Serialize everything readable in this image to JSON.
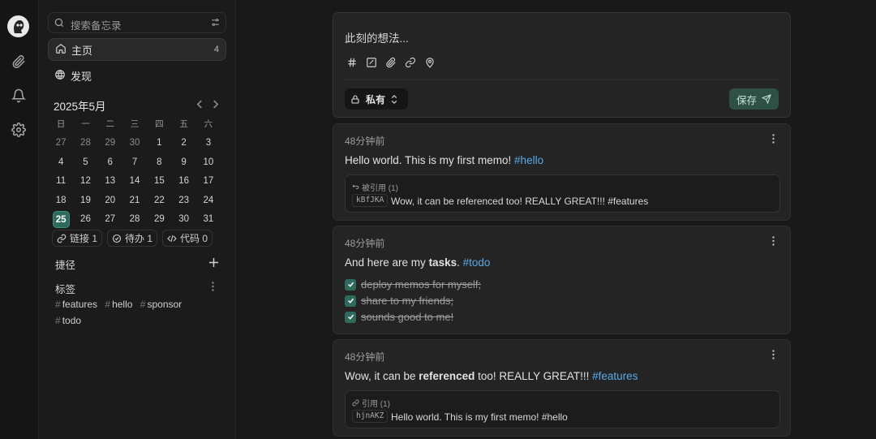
{
  "search": {
    "placeholder": "搜索备忘录"
  },
  "nav": {
    "home": {
      "label": "主页",
      "count": "4"
    },
    "explore": {
      "label": "发现"
    }
  },
  "calendar": {
    "title": "2025年5月",
    "weekdays": [
      "日",
      "一",
      "二",
      "三",
      "四",
      "五",
      "六"
    ],
    "weeks": [
      [
        "27",
        "28",
        "29",
        "30",
        "1",
        "2",
        "3"
      ],
      [
        "4",
        "5",
        "6",
        "7",
        "8",
        "9",
        "10"
      ],
      [
        "11",
        "12",
        "13",
        "14",
        "15",
        "16",
        "17"
      ],
      [
        "18",
        "19",
        "20",
        "21",
        "22",
        "23",
        "24"
      ],
      [
        "25",
        "26",
        "27",
        "28",
        "29",
        "30",
        "31"
      ]
    ],
    "today": "25"
  },
  "stats": {
    "links": "链接 1",
    "todo": "待办 1",
    "code": "代码 0"
  },
  "shortcuts": {
    "title": "捷径"
  },
  "tags": {
    "title": "标签",
    "items": [
      "features",
      "hello",
      "sponsor",
      "todo"
    ]
  },
  "editor": {
    "placeholder": "此刻的想法...",
    "visibility": "私有",
    "save": "保存"
  },
  "memos": [
    {
      "time": "48分钟前",
      "text_before": "Hello world. This is my first memo! ",
      "tag": "#hello",
      "ref": {
        "label": "被引用 (1)",
        "id": "kBfJKA",
        "text": "Wow, it can be referenced too! REALLY GREAT!!! #features"
      }
    },
    {
      "time": "48分钟前",
      "text_before": "And here are my ",
      "bold": "tasks",
      "text_after": ". ",
      "tag": "#todo",
      "tasks": [
        "deploy memos for myself;",
        "share to my friends;",
        "sounds good to me!"
      ]
    },
    {
      "time": "48分钟前",
      "text_before": "Wow, it can be ",
      "bold": "referenced",
      "text_after": " too! REALLY GREAT!!! ",
      "tag": "#features",
      "ref": {
        "label": "引用 (1)",
        "id": "hjnAKZ",
        "text": "Hello world. This is my first memo! #hello"
      }
    }
  ],
  "colors": {
    "accent": "#2e6b5c",
    "tag_link": "#5aa9e6",
    "background": "#181818"
  }
}
